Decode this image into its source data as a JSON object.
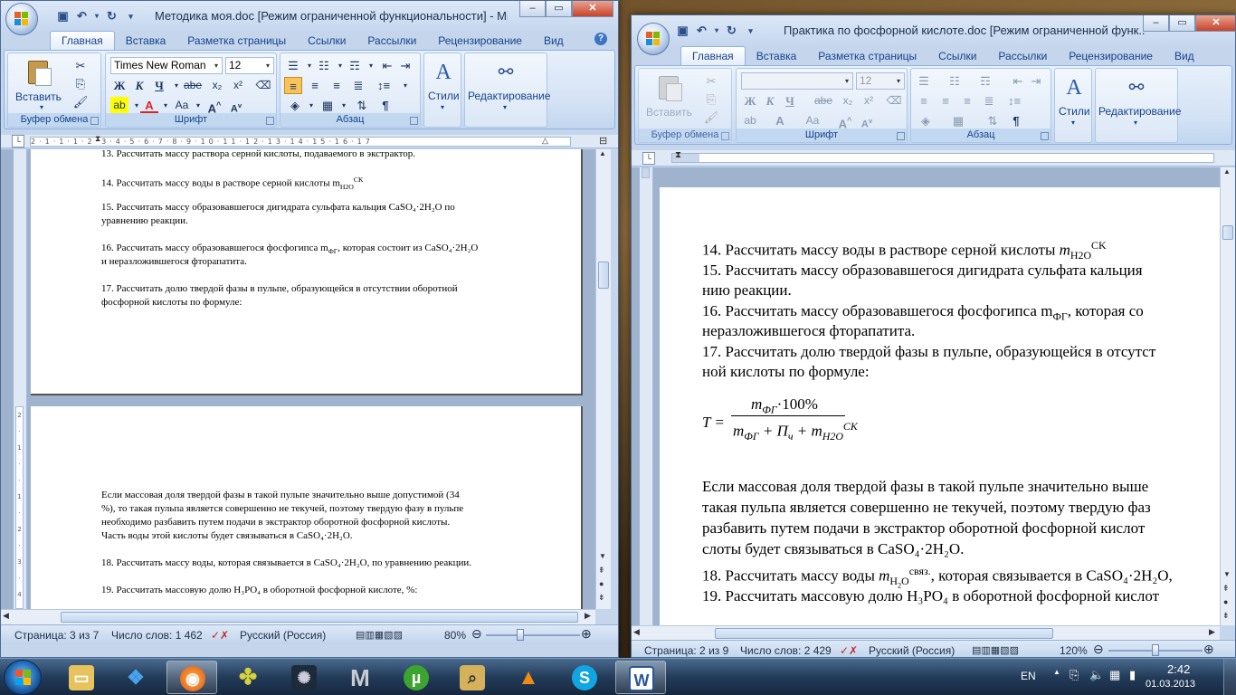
{
  "left_window": {
    "title": "Методика моя.doc [Режим ограниченной функциональности] - Mic...",
    "tabs": [
      "Главная",
      "Вставка",
      "Разметка страницы",
      "Ссылки",
      "Рассылки",
      "Рецензирование",
      "Вид"
    ],
    "active_tab": "Главная",
    "font_name": "Times New Roman",
    "font_size": "12",
    "groups": {
      "clipboard": "Буфер обмена",
      "font": "Шрифт",
      "paragraph": "Абзац",
      "styles": "Стили",
      "editing": "Редактирование",
      "paste": "Вставить"
    },
    "ruler_text": "2·1·1·1·2·3·4·5·6·7·8·9·10·11·12·13·14·15·16·17",
    "page1_lines": [
      "13. Рассчитать массу раствора серной кислоты, подаваемого в экстрактор.",
      "14. Рассчитать массу воды в растворе серной кислоты m",
      "15. Рассчитать массу образовавшегося дигидрата сульфата кальция CaSO₄·2H₂O по",
      "уравнению реакции.",
      "16. Рассчитать массу образовавшегося фосфогипса m",
      "и неразложившегося фторапатита.",
      "17. Рассчитать долю твердой фазы в пульпе, образующейся в отсутствии оборотной",
      "фосфорной кислоты по формуле:"
    ],
    "p1_l2_sub": "H2O",
    "p1_l2_sup": "CK",
    "p1_l5_sub": "ФГ",
    "p1_l5_rest": ", которая состоит из CaSO₄·2H₂O",
    "page2_lines": [
      "Если массовая доля твердой фазы в такой пульпе значительно выше допустимой (34",
      "%), то такая пульпа является совершенно не текучей, поэтому твердую фазу в пульпе",
      "необходимо разбавить путем подачи в экстрактор оборотной фосфорной кислоты.",
      "Часть воды этой кислоты будет связываться в CaSO₄·2H₂O.",
      "18. Рассчитать массу воды, которая связывается в CaSO₄·2H₂O, по уравнению реакции.",
      "19. Рассчитать массовую долю H₃PO₄ в оборотной фосфорной кислоте, %:"
    ],
    "status": {
      "page": "Страница: 3 из 7",
      "words": "Число слов: 1 462",
      "lang": "Русский (Россия)",
      "zoom": "80%"
    },
    "zoom_level_percent": 80
  },
  "right_window": {
    "title": "Практика по фосфорной кислоте.doc [Режим ограниченной функ...",
    "tabs": [
      "Главная",
      "Вставка",
      "Разметка страницы",
      "Ссылки",
      "Рассылки",
      "Рецензирование",
      "Вид"
    ],
    "active_tab": "Главная",
    "font_size": "12",
    "groups": {
      "clipboard": "Буфер обмена",
      "font": "Шрифт",
      "paragraph": "Абзац",
      "styles": "Стили",
      "editing": "Редактирование",
      "paste": "Вставить"
    },
    "lines": [
      "14. Рассчитать массу воды в растворе серной кислоты",
      "15. Рассчитать массу образовавшегося дигидрата сульфата кальция",
      "нию реакции.",
      "16. Рассчитать массу образовавшегося фосфогипса m",
      "неразложившегося фторапатита.",
      "17. Рассчитать долю твердой фазы в пульпе, образующейся в отсутст",
      "ной кислоты по формуле:",
      "Если массовая доля твердой фазы в такой пульпе значительно выше",
      "такая пульпа является совершенно не текучей, поэтому твердую фаз",
      "разбавить путем подачи в экстрактор оборотной фосфорной кислот",
      "слоты будет связываться в CaSO₄·2H₂O.",
      "18. Рассчитать массу воды",
      ", которая связывается в CaSO₄·2H₂O,",
      "19. Рассчитать массовую долю H₃PO₄ в оборотной фосфорной кислот"
    ],
    "l4_sub": "ФГ",
    "l4_rest": ", которая со",
    "formula": {
      "lhs": "T =",
      "num_m": "m",
      "num_sub": "ФГ",
      "num_rest": "·100%",
      "den": "m",
      "den_sub": "ФГ",
      "den_mid": "+ П",
      "den_sub2": "ч",
      "den_plus": "+ m",
      "den_sub3": "H2O",
      "den_sup3": "CK"
    },
    "m_h2o_sub": "H2O",
    "m_h2o_sup": "CK",
    "m_svyaz_sup": "связ.",
    "status": {
      "page": "Страница: 2 из 9",
      "words": "Число слов: 2 429",
      "lang": "Русский (Россия)",
      "zoom": "120%"
    },
    "zoom_level_percent": 120
  },
  "taskbar": {
    "lang": "EN",
    "time": "2:42",
    "date": "01.03.2013",
    "apps": [
      "windows-explorer",
      "dropbox",
      "firefox",
      "puzzle-app",
      "fan-app",
      "m-app",
      "utorrent",
      "search-app",
      "vlc",
      "skype",
      "word"
    ]
  }
}
